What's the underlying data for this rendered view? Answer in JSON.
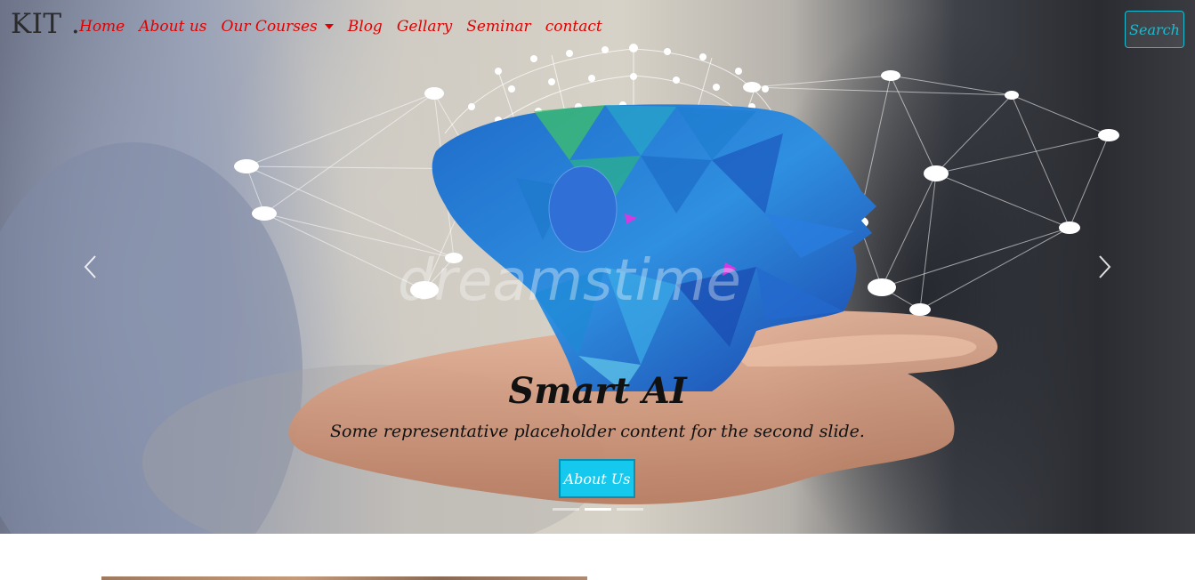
{
  "brand": {
    "name": "KIT ."
  },
  "nav": {
    "home": "Home",
    "about": "About us",
    "courses": "Our Courses",
    "blog": "Blog",
    "gallery": "Gellary",
    "seminar": "Seminar",
    "contact": "contact"
  },
  "search": {
    "label": "Search"
  },
  "carousel": {
    "active_slide": 2,
    "slide_count": 3,
    "title": "Smart AI",
    "text": "Some representative placeholder content for the second slide.",
    "button": "About Us",
    "watermark": "dreamstime"
  },
  "colors": {
    "nav_link": "#e00000",
    "accent": "#14c8ee",
    "search_border": "#16bdd3"
  },
  "icons": {
    "prev": "chevron-left-icon",
    "next": "chevron-right-icon",
    "dropdown": "caret-down-icon"
  }
}
